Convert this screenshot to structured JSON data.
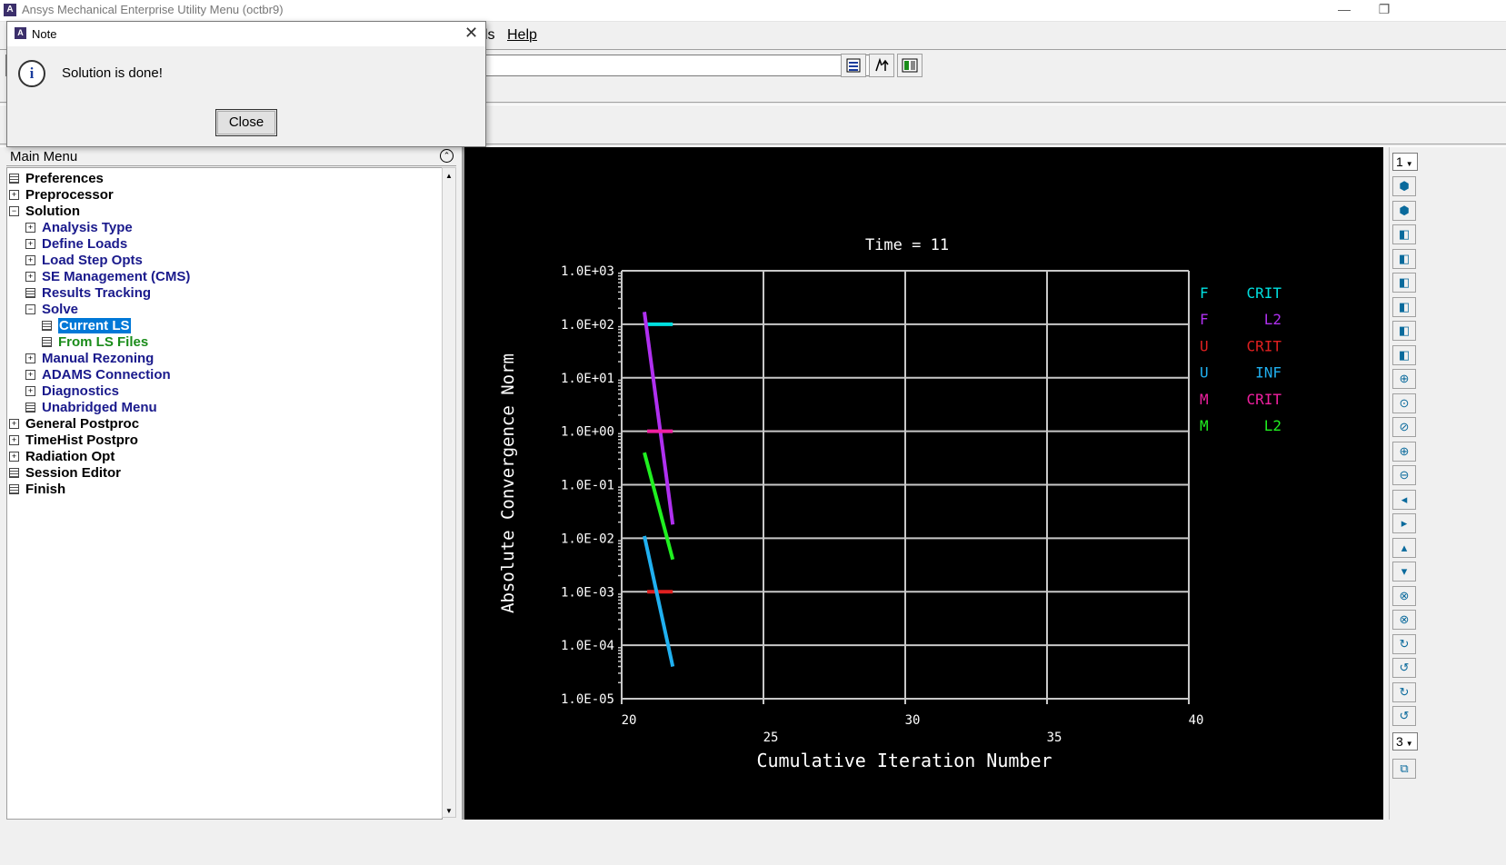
{
  "window": {
    "title": "Ansys Mechanical Enterprise Utility Menu (octbr9)",
    "icon_letter": "A",
    "controls": [
      "—",
      "❐"
    ]
  },
  "menubar": {
    "items": [
      "ls",
      "Help"
    ]
  },
  "toolbar": {
    "command_value": ""
  },
  "dialog": {
    "title": "Note",
    "icon_letter": "A",
    "close_glyph": "✕",
    "info_glyph": "i",
    "message": "Solution is done!",
    "button": "Close"
  },
  "main_menu": {
    "title": "Main Menu",
    "collapse_glyph": "⌃",
    "items": [
      {
        "label": "Preferences",
        "icon": "cmd",
        "level": 0,
        "color": "black"
      },
      {
        "label": "Preprocessor",
        "icon": "plus",
        "level": 0,
        "color": "black"
      },
      {
        "label": "Solution",
        "icon": "minus",
        "level": 0,
        "color": "black"
      },
      {
        "label": "Analysis Type",
        "icon": "plus",
        "level": 1,
        "color": "blue"
      },
      {
        "label": "Define Loads",
        "icon": "plus",
        "level": 1,
        "color": "blue"
      },
      {
        "label": "Load Step Opts",
        "icon": "plus",
        "level": 1,
        "color": "blue"
      },
      {
        "label": "SE Management (CMS)",
        "icon": "plus",
        "level": 1,
        "color": "blue"
      },
      {
        "label": "Results Tracking",
        "icon": "cmd",
        "level": 1,
        "color": "blue"
      },
      {
        "label": "Solve",
        "icon": "minus",
        "level": 1,
        "color": "blue"
      },
      {
        "label": "Current LS",
        "icon": "cmd",
        "level": 2,
        "color": "selected"
      },
      {
        "label": "From LS Files",
        "icon": "cmd",
        "level": 2,
        "color": "green"
      },
      {
        "label": "Manual Rezoning",
        "icon": "plus",
        "level": 1,
        "color": "blue"
      },
      {
        "label": "ADAMS Connection",
        "icon": "plus",
        "level": 1,
        "color": "blue"
      },
      {
        "label": "Diagnostics",
        "icon": "plus",
        "level": 1,
        "color": "blue"
      },
      {
        "label": "Unabridged Menu",
        "icon": "cmd",
        "level": 1,
        "color": "blue"
      },
      {
        "label": "General Postproc",
        "icon": "plus",
        "level": 0,
        "color": "black"
      },
      {
        "label": "TimeHist Postpro",
        "icon": "plus",
        "level": 0,
        "color": "black"
      },
      {
        "label": "Radiation Opt",
        "icon": "plus",
        "level": 0,
        "color": "black"
      },
      {
        "label": "Session Editor",
        "icon": "cmd",
        "level": 0,
        "color": "black"
      },
      {
        "label": "Finish",
        "icon": "cmd",
        "level": 0,
        "color": "black"
      }
    ]
  },
  "right_toolbar": {
    "window_number": "1",
    "zoom_number": "3",
    "icons": [
      "iso-view-icon",
      "oblique-view-icon",
      "front-view-icon",
      "right-view-icon",
      "top-view-icon",
      "back-view-icon",
      "left-view-icon",
      "bottom-view-icon",
      "zoom-icon",
      "box-zoom-icon",
      "win-zoom-icon",
      "zoom-in-icon",
      "zoom-out-icon",
      "pan-left-icon",
      "pan-right-icon",
      "pan-up-icon",
      "pan-down-icon",
      "rotate-x-pos-icon",
      "rotate-x-neg-icon",
      "rotate-y-pos-icon",
      "rotate-y-neg-icon",
      "rotate-z-pos-icon",
      "rotate-z-neg-icon"
    ]
  },
  "chart_data": {
    "type": "line",
    "title": "Time = 11",
    "xlabel": "Cumulative Iteration Number",
    "ylabel": "Absolute Convergence Norm",
    "xlim": [
      20,
      40
    ],
    "x_ticks": [
      "20",
      "25",
      "30",
      "35",
      "40"
    ],
    "y_scale": "log",
    "ylim": [
      1e-05,
      1000.0
    ],
    "y_ticks": [
      "1.0E-05",
      "1.0E-04",
      "1.0E-03",
      "1.0E-02",
      "1.0E-01",
      "1.0E+00",
      "1.0E+01",
      "1.0E+02",
      "1.0E+03"
    ],
    "grid": true,
    "legend_position": "right",
    "series": [
      {
        "legend_dof": "F",
        "legend_type": "CRIT",
        "color": "#00e0e0",
        "x": [
          20.9,
          21.8
        ],
        "y": [
          100,
          100
        ]
      },
      {
        "legend_dof": "F",
        "legend_type": "L2",
        "color": "#b030f0",
        "x": [
          20.8,
          21.8
        ],
        "y": [
          170,
          0.018
        ]
      },
      {
        "legend_dof": "U",
        "legend_type": "CRIT",
        "color": "#e02020",
        "x": [
          20.9,
          21.8
        ],
        "y": [
          0.001,
          0.001
        ]
      },
      {
        "legend_dof": "U",
        "legend_type": "INF",
        "color": "#20b0f0",
        "x": [
          20.8,
          21.8
        ],
        "y": [
          0.011,
          4e-05
        ]
      },
      {
        "legend_dof": "M",
        "legend_type": "CRIT",
        "color": "#f020a0",
        "x": [
          20.9,
          21.8
        ],
        "y": [
          1,
          1
        ]
      },
      {
        "legend_dof": "M",
        "legend_type": "L2",
        "color": "#20f020",
        "x": [
          20.8,
          21.8
        ],
        "y": [
          0.4,
          0.004
        ]
      }
    ]
  }
}
